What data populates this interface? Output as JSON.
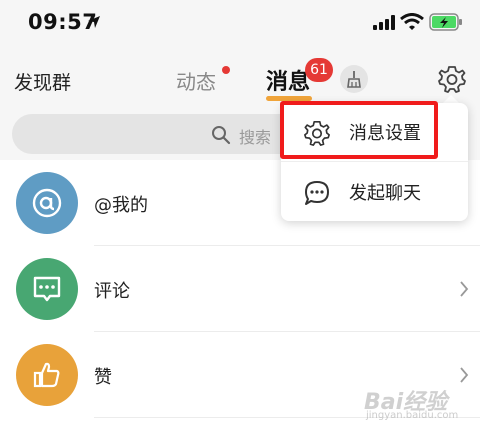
{
  "status_bar": {
    "time": "09:57"
  },
  "nav": {
    "left": "发现群",
    "tab_feed": "动态",
    "tab_messages": "消息",
    "messages_badge": "61"
  },
  "search": {
    "placeholder": "搜索"
  },
  "list": {
    "items": [
      {
        "label": "@我的",
        "color": "#5f9cc4"
      },
      {
        "label": "评论",
        "color": "#48a772"
      },
      {
        "label": "赞",
        "color": "#e8a23a"
      }
    ]
  },
  "menu": {
    "items": [
      {
        "label": "消息设置",
        "icon": "gear-icon"
      },
      {
        "label": "发起聊天",
        "icon": "chat-bubble-icon"
      }
    ]
  },
  "watermark": {
    "text": "Bai经验",
    "sub": "jingyan.baidu.com"
  },
  "colors": {
    "accent": "#f0a43a",
    "badge": "#e53935",
    "highlight": "#f01b1b"
  }
}
